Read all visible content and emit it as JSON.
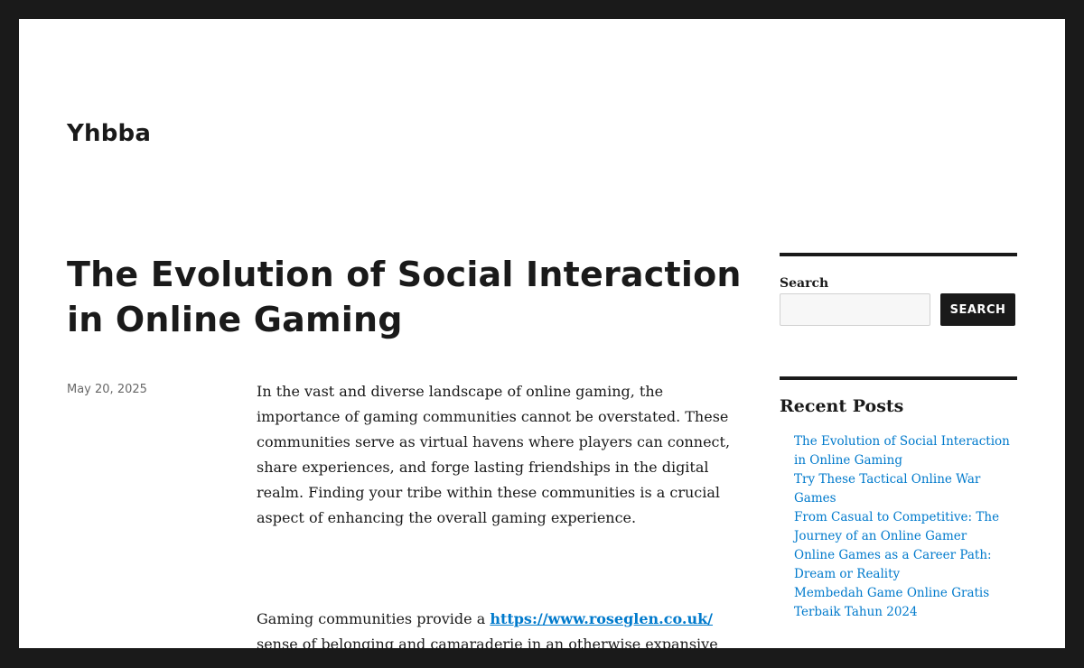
{
  "site": {
    "title": "Yhbba"
  },
  "post": {
    "title": "The Evolution of Social Interaction in Online Gaming",
    "date": "May 20, 2025",
    "paragraph1": "In the vast and diverse landscape of online gaming, the importance of gaming communities cannot be overstated. These communities serve as virtual havens where players can connect, share experiences, and forge lasting friendships in the digital realm. Finding your tribe within these communities is a crucial aspect of enhancing the overall gaming experience.",
    "paragraph2_before_link": "Gaming communities provide a ",
    "paragraph2_link": "https://www.roseglen.co.uk/",
    "paragraph2_after_link": " sense of belonging and camaraderie in an otherwise expansive and"
  },
  "sidebar": {
    "search_label": "Search",
    "search_value": "",
    "search_button": "SEARCH",
    "recent_posts_title": "Recent Posts",
    "recent_posts": [
      "The Evolution of Social Interaction in Online Gaming",
      "Try These Tactical Online War Games",
      "From Casual to Competitive: The Journey of an Online Gamer",
      "Online Games as a Career Path: Dream or Reality",
      "Membedah Game Online Gratis Terbaik Tahun 2024"
    ]
  },
  "colors": {
    "frame_border": "#1a1a1a",
    "page_background": "#ffffff",
    "link": "#007acc",
    "text": "#1a1a1a",
    "meta_text": "#686868"
  }
}
